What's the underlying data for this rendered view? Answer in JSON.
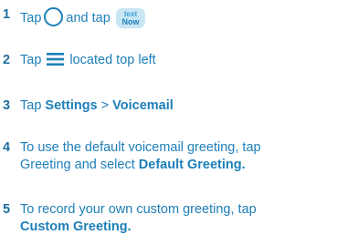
{
  "steps": [
    {
      "number": "1",
      "parts": {
        "a": "Tap",
        "b": "and tap"
      },
      "icons": [
        "circle-icon",
        "textnow-app-icon"
      ]
    },
    {
      "number": "2",
      "parts": {
        "a": "Tap",
        "b": "located top left"
      },
      "icons": [
        "hamburger-menu-icon"
      ]
    },
    {
      "number": "3",
      "parts": {
        "a": "Tap",
        "b": "Settings",
        "c": ">",
        "d": "Voicemail"
      }
    },
    {
      "number": "4",
      "parts": {
        "a": "To use the default voicemail greeting, tap",
        "b": "Greeting and select",
        "c": "Default Greeting."
      }
    },
    {
      "number": "5",
      "parts": {
        "a": "To record your own custom greeting, tap",
        "b": "Custom Greeting."
      }
    }
  ],
  "app_icon_text": {
    "top": "text",
    "bottom": "Now"
  },
  "colors": {
    "text": "#1d7fb8",
    "number": "#1f6f9e",
    "app_icon_bg": "#c9e6f5"
  }
}
